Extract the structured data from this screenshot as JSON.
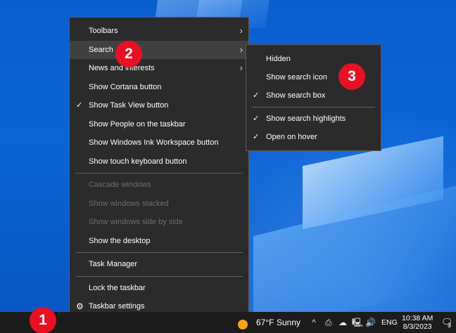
{
  "context_menu": {
    "items": [
      {
        "label": "Toolbars",
        "submenu": true
      },
      {
        "label": "Search",
        "submenu": true,
        "highlighted": true
      },
      {
        "label": "News and interests",
        "submenu": true
      },
      {
        "label": "Show Cortana button"
      },
      {
        "label": "Show Task View button",
        "checked": true
      },
      {
        "label": "Show People on the taskbar"
      },
      {
        "label": "Show Windows Ink Workspace button"
      },
      {
        "label": "Show touch keyboard button"
      },
      {
        "label": "Cascade windows",
        "disabled": true
      },
      {
        "label": "Show windows stacked",
        "disabled": true
      },
      {
        "label": "Show windows side by side",
        "disabled": true
      },
      {
        "label": "Show the desktop"
      },
      {
        "label": "Task Manager"
      },
      {
        "label": "Lock the taskbar"
      },
      {
        "label": "Taskbar settings",
        "icon": "gear-icon"
      }
    ]
  },
  "search_submenu": {
    "items": [
      {
        "label": "Hidden"
      },
      {
        "label": "Show search icon"
      },
      {
        "label": "Show search box",
        "checked": true
      },
      {
        "label": "Show search highlights",
        "checked": true
      },
      {
        "label": "Open on hover",
        "checked": true
      }
    ]
  },
  "badges": {
    "one": "1",
    "two": "2",
    "three": "3"
  },
  "glyphs": {
    "chevron": "›",
    "check": "✓",
    "gear": "⚙"
  },
  "taskbar": {
    "weather": {
      "temperature": "67°F",
      "condition": "Sunny"
    },
    "tray_icons": {
      "chevron_up": "^",
      "meet_now": "⎙",
      "onedrive": "☁",
      "network": "🖳",
      "volume": "🔊"
    },
    "language": "ENG",
    "time": "10:38 AM",
    "date": "8/3/2023",
    "notification_count": "3",
    "notification_glyph": "🗨"
  },
  "colors": {
    "menu_bg": "#2b2b2b",
    "menu_highlight": "#414141",
    "badge": "#e81123",
    "taskbar": "#1c1c1c",
    "desktop": "#0a5fcf"
  }
}
